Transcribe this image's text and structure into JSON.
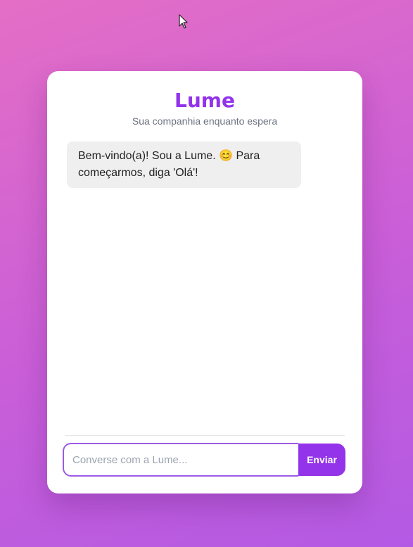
{
  "app": {
    "title": "Lume",
    "subtitle": "Sua companhia enquanto espera"
  },
  "messages": [
    {
      "sender": "bot",
      "text": "Bem-vindo(a)! Sou a Lume. 😊 Para começarmos, diga 'Olá'!"
    }
  ],
  "composer": {
    "placeholder": "Converse com a Lume...",
    "value": "",
    "send_label": "Enviar"
  },
  "colors": {
    "accent": "#9333ea",
    "background_start": "#e46ec6",
    "background_end": "#b35ae4",
    "bubble_bg": "#efefef"
  },
  "icons": {
    "cursor": "mouse-pointer-icon"
  }
}
